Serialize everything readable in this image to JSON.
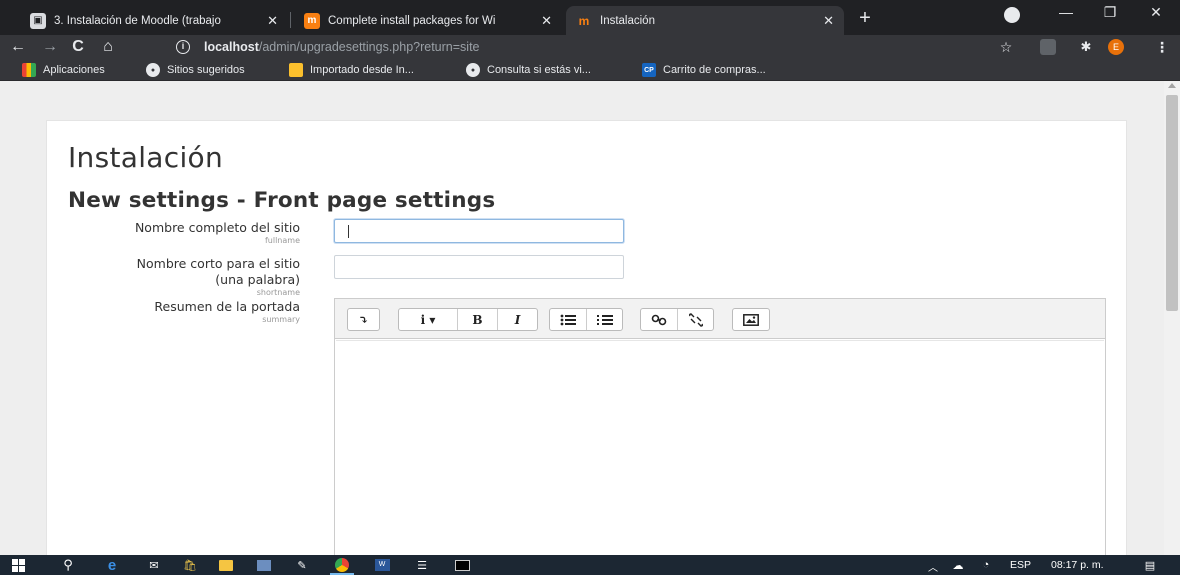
{
  "browser": {
    "tabs": [
      {
        "title": "3. Instalación de Moodle (trabajo",
        "icon": "document-icon",
        "active": false
      },
      {
        "title": "Complete install packages for Wi",
        "icon": "moodle-icon",
        "active": false
      },
      {
        "title": "Instalación",
        "icon": "moodle-icon",
        "active": true
      }
    ],
    "url_host": "localhost",
    "url_path": "/admin/upgradesettings.php?return=site",
    "profile_initial": "E",
    "bookmarks": [
      {
        "label": "Aplicaciones",
        "icon": "apps-grid-icon"
      },
      {
        "label": "Sitios sugeridos",
        "icon": "globe-icon"
      },
      {
        "label": "Importado desde In...",
        "icon": "folder-icon"
      },
      {
        "label": "Consulta si estás vi...",
        "icon": "globe-icon"
      },
      {
        "label": "Carrito de compras...",
        "icon": "cp-icon",
        "badge": "CP"
      }
    ]
  },
  "page": {
    "title": "Instalación",
    "subtitle": "New settings - Front page settings",
    "fields": [
      {
        "label": "Nombre completo del sitio",
        "name": "fullname",
        "value": "",
        "type": "text"
      },
      {
        "label_line1": "Nombre corto para el sitio",
        "label_line2": "(una palabra)",
        "name": "shortname",
        "value": "",
        "type": "text"
      },
      {
        "label": "Resumen de la portada",
        "name": "summary",
        "type": "editor"
      }
    ],
    "editor_toolbar": {
      "collapse": "⤵",
      "info": "i ▾",
      "bold": "B",
      "italic": "I"
    }
  },
  "taskbar": {
    "language": "ESP",
    "time": "08:17 p. m."
  }
}
